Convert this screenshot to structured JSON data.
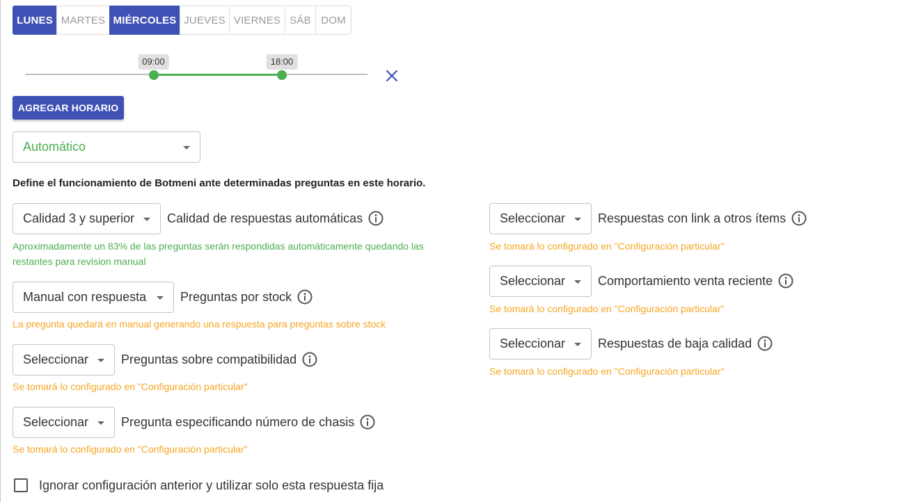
{
  "days": [
    "LUNES",
    "MARTES",
    "MIÉRCOLES",
    "JUEVES",
    "VIERNES",
    "SÁB",
    "DOM"
  ],
  "active_days": [
    "LUNES",
    "MIÉRCOLES"
  ],
  "schedule": {
    "start": "09:00",
    "end": "18:00",
    "range_start_fraction": 0.375,
    "range_end_fraction": 0.75
  },
  "add_schedule_label": "AGREGAR HORARIO",
  "mode_select": {
    "value": "Automático",
    "color": "#4caf50"
  },
  "intro_text": "Define el funcionamiento de Botmeni ante determinadas preguntas en este horario.",
  "left_settings": [
    {
      "select": "Calidad 3 y superior",
      "label": "Calidad de respuestas automáticas",
      "help": "Aproximadamente un 83% de las preguntas serán respondidas automáticamente quedando las restantes para revision manual",
      "help_color": "green"
    },
    {
      "select": "Manual con respuesta",
      "label": "Preguntas por stock",
      "help": "La pregunta quedará en manual generando una respuesta para preguntas sobre stock",
      "help_color": "orange"
    },
    {
      "select": "Seleccionar",
      "label": "Preguntas sobre compatibilidad",
      "help": "Se tomará lo configurado en \"Configuración particular\"",
      "help_color": "orange"
    },
    {
      "select": "Seleccionar",
      "label": "Pregunta especificando número de chasis",
      "help": "Se tomará lo configurado en \"Configuración particular\"",
      "help_color": "orange"
    }
  ],
  "right_settings": [
    {
      "select": "Seleccionar",
      "label": "Respuestas con link a otros ítems",
      "help": "Se tomará lo configurado en \"Configuración particular\"",
      "help_color": "orange"
    },
    {
      "select": "Seleccionar",
      "label": "Comportamiento venta reciente",
      "help": "Se tomará lo configurado en \"Configuración particular\"",
      "help_color": "orange"
    },
    {
      "select": "Seleccionar",
      "label": "Respuestas de baja calidad",
      "help": "Se tomará lo configurado en \"Configuración particular\"",
      "help_color": "orange"
    }
  ],
  "fixed_response_checkbox": {
    "label": "Ignorar configuración anterior y utilizar solo esta respuesta fija",
    "checked": false
  },
  "colors": {
    "primary": "#3f51b5",
    "success": "#4caf50",
    "warning": "#f5a623"
  }
}
